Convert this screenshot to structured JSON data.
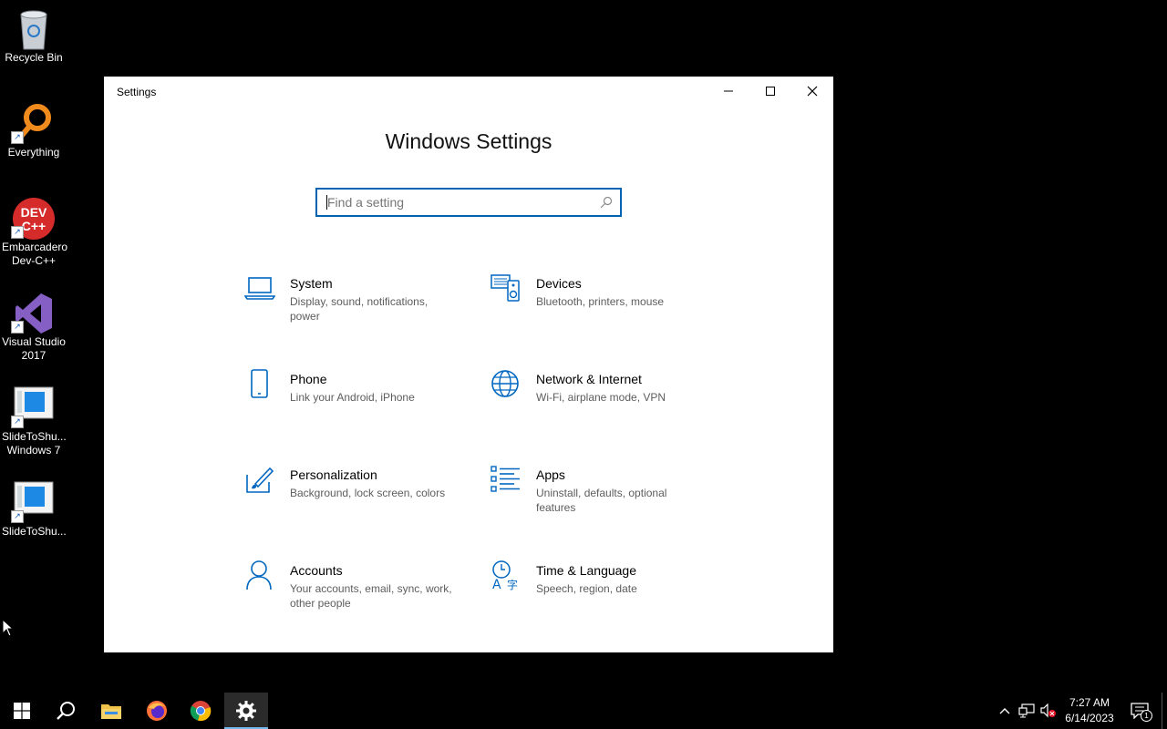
{
  "desktop": {
    "icons": [
      {
        "label": "Recycle Bin",
        "icon": "recycle-bin-icon"
      },
      {
        "label": "Everything",
        "icon": "everything-search-icon"
      },
      {
        "label": "Embarcadero Dev-C++",
        "icon": "devcpp-icon",
        "badge": "DEV C++"
      },
      {
        "label": "Visual Studio 2017",
        "icon": "visual-studio-icon"
      },
      {
        "label": "SlideToShu... Windows 7",
        "icon": "slide-to-shutdown-icon"
      },
      {
        "label": "SlideToShu...",
        "icon": "slide-to-shutdown-icon"
      }
    ]
  },
  "window": {
    "title": "Settings",
    "heading": "Windows Settings",
    "search": {
      "placeholder": "Find a setting"
    },
    "categories": [
      {
        "name": "System",
        "desc": "Display, sound, notifications, power",
        "icon": "laptop-icon"
      },
      {
        "name": "Devices",
        "desc": "Bluetooth, printers, mouse",
        "icon": "devices-icon"
      },
      {
        "name": "Phone",
        "desc": "Link your Android, iPhone",
        "icon": "phone-icon"
      },
      {
        "name": "Network & Internet",
        "desc": "Wi-Fi, airplane mode, VPN",
        "icon": "globe-icon"
      },
      {
        "name": "Personalization",
        "desc": "Background, lock screen, colors",
        "icon": "paint-brush-icon"
      },
      {
        "name": "Apps",
        "desc": "Uninstall, defaults, optional features",
        "icon": "apps-list-icon"
      },
      {
        "name": "Accounts",
        "desc": "Your accounts, email, sync, work, other people",
        "icon": "person-icon"
      },
      {
        "name": "Time & Language",
        "desc": "Speech, region, date",
        "icon": "time-language-icon"
      }
    ]
  },
  "taskbar": {
    "clock": {
      "time": "7:27 AM",
      "date": "6/14/2023"
    },
    "notification_count": "1"
  },
  "colors": {
    "accent": "#0063b1",
    "icon_blue": "#0067c0"
  }
}
